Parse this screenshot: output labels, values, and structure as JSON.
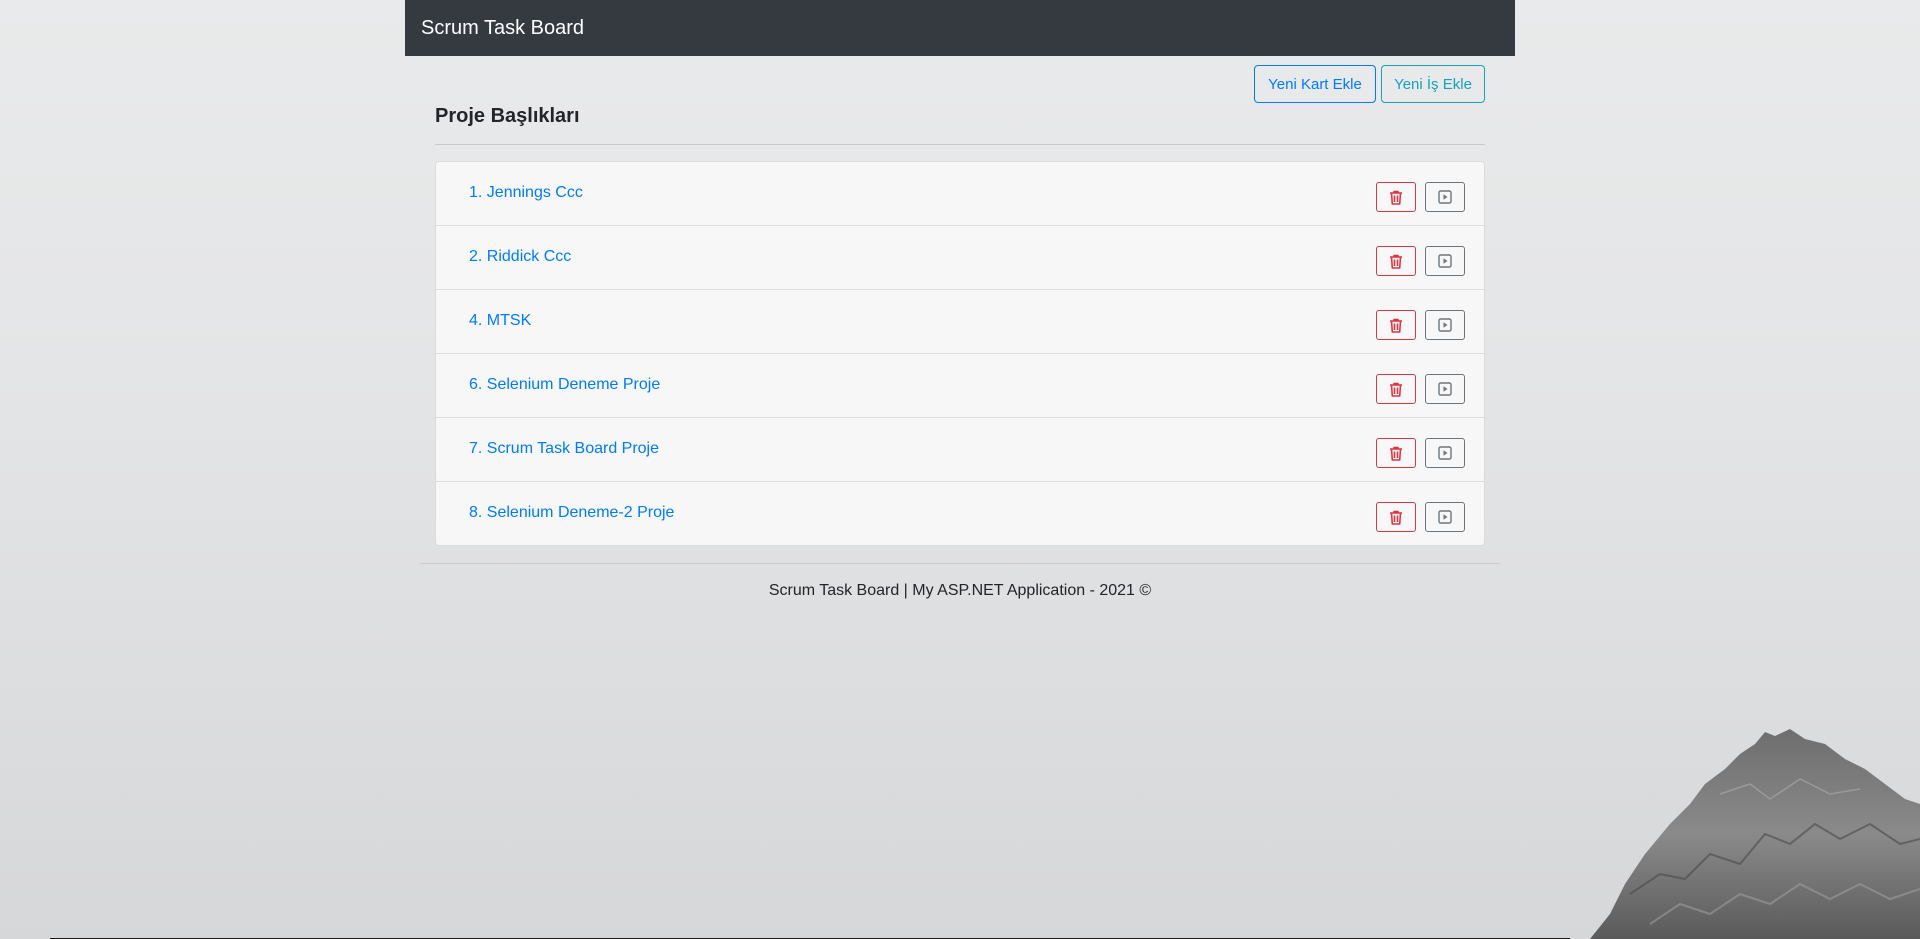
{
  "navbar": {
    "brand": "Scrum Task Board"
  },
  "toolbar": {
    "add_card_label": "Yeni Kart Ekle",
    "add_task_label": "Yeni İş Ekle"
  },
  "page": {
    "title": "Proje Başlıkları"
  },
  "projects": [
    {
      "label": "1. Jennings Ccc"
    },
    {
      "label": "2. Riddick Ccc"
    },
    {
      "label": "4. MTSK"
    },
    {
      "label": "6. Selenium Deneme Proje"
    },
    {
      "label": "7. Scrum Task Board Proje"
    },
    {
      "label": "8. Selenium Deneme-2 Proje"
    }
  ],
  "icons": {
    "delete": "trash-icon",
    "open": "play-square-icon"
  },
  "footer": {
    "text": "Scrum Task Board | My ASP.NET Application - 2021 ©"
  },
  "colors": {
    "navbar": "#343a40",
    "primary": "#007bff",
    "info": "#17a2b8",
    "danger": "#dc3545",
    "secondary": "#6c757d"
  }
}
